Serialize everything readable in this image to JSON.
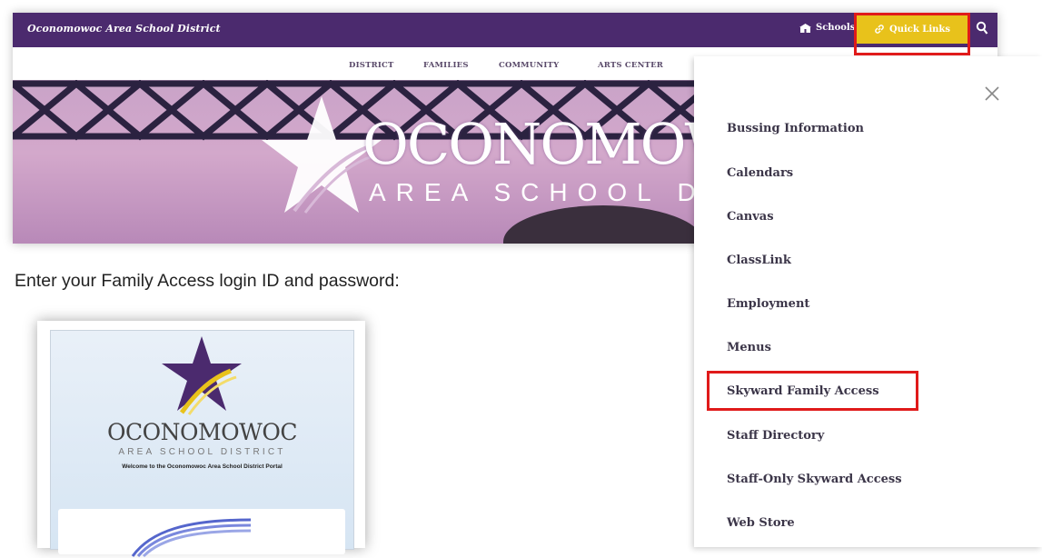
{
  "site": {
    "district_name": "Oconomowoc Area School District",
    "schools_label": "Schools",
    "quicklinks_label": "Quick Links",
    "nav": [
      "DISTRICT",
      "FAMILIES",
      "COMMUNITY",
      "ARTS CENTER"
    ],
    "hero_title": "OCONOMOWOC",
    "hero_sub": "AREA SCHOOL DISTRICT",
    "colors": {
      "brand_purple": "#4b2a6e",
      "quicklinks_gold": "#e8c21b",
      "highlight_red": "#e01a1a"
    }
  },
  "instruction": "Enter your Family Access login ID and password:",
  "login": {
    "title": "OCONOMOWOC",
    "subtitle": "AREA SCHOOL DISTRICT",
    "welcome": "Welcome to the Oconomowoc Area School District Portal"
  },
  "quick_links": {
    "close_icon": "close-icon",
    "items": [
      "Bussing Information",
      "Calendars",
      "Canvas",
      "ClassLink",
      "Employment",
      "Menus",
      "Skyward Family Access",
      "Staff Directory",
      "Staff-Only Skyward Access",
      "Web Store"
    ],
    "highlighted_item": "Skyward Family Access"
  }
}
